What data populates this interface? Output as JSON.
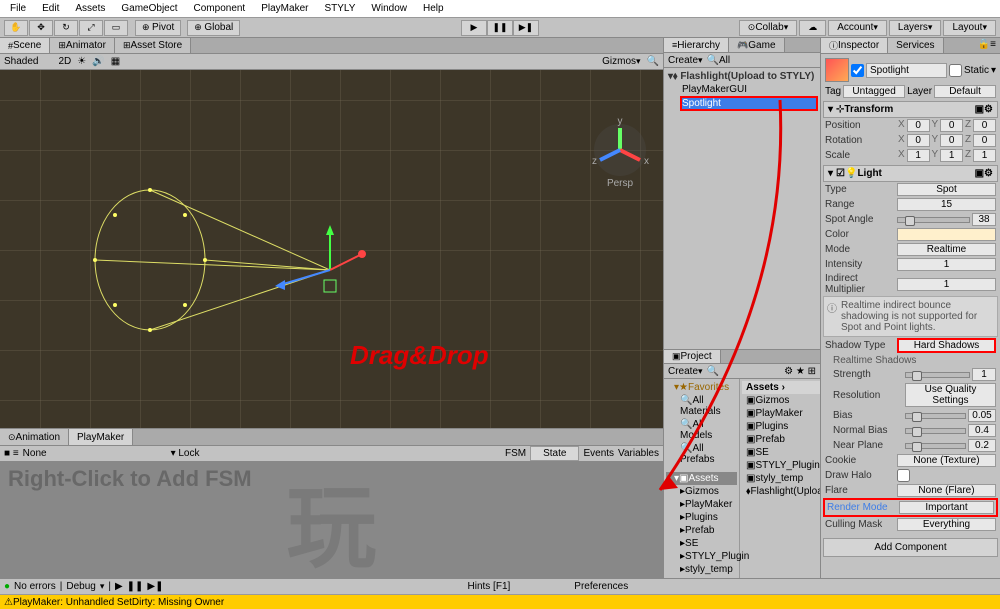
{
  "menu": [
    "File",
    "Edit",
    "Assets",
    "GameObject",
    "Component",
    "PlayMaker",
    "STYLY",
    "Window",
    "Help"
  ],
  "toolbar": {
    "pivot": "Pivot",
    "global": "Global",
    "collab": "Collab",
    "account": "Account",
    "layers": "Layers",
    "layout": "Layout"
  },
  "scene_tabs": {
    "scene": "Scene",
    "animator": "Animator",
    "asset_store": "Asset Store"
  },
  "scene_toolbar": {
    "shaded": "Shaded",
    "two_d": "2D",
    "gizmos": "Gizmos"
  },
  "anim_tabs": {
    "animation": "Animation",
    "playmaker": "PlayMaker"
  },
  "pm_toolbar": {
    "none": "None",
    "lock": "Lock",
    "fsm": "FSM",
    "state": "State",
    "events": "Events",
    "variables": "Variables"
  },
  "pm_hint": "Right-Click to Add FSM",
  "hier_tabs": {
    "hierarchy": "Hierarchy",
    "game": "Game"
  },
  "hier_toolbar": {
    "create": "Create"
  },
  "hierarchy": {
    "scene": "Flashlight(Upload to STYLY)",
    "items": [
      "PlayMakerGUI",
      "Spotlight"
    ]
  },
  "proj_tabs": {
    "project": "Project"
  },
  "proj_toolbar": {
    "create": "Create"
  },
  "project": {
    "favorites": "Favorites",
    "fav_items": [
      "All Materials",
      "All Models",
      "All Prefabs"
    ],
    "assets_root": "Assets",
    "tree": [
      "Gizmos",
      "PlayMaker",
      "Plugins",
      "Prefab",
      "SE",
      "STYLY_Plugin",
      "styly_temp"
    ],
    "breadcrumb": "Assets ›",
    "list": [
      "Gizmos",
      "PlayMaker",
      "Plugins",
      "Prefab",
      "SE",
      "STYLY_Plugin",
      "styly_temp",
      "Flashlight(Upload"
    ]
  },
  "insp_tabs": {
    "inspector": "Inspector",
    "services": "Services"
  },
  "inspector": {
    "name": "Spotlight",
    "static": "Static",
    "tag_label": "Tag",
    "tag": "Untagged",
    "layer_label": "Layer",
    "layer": "Default",
    "transform": "Transform",
    "position": "Position",
    "rotation": "Rotation",
    "scale": "Scale",
    "pos": {
      "x": "0",
      "y": "0",
      "z": "0"
    },
    "rot": {
      "x": "0",
      "y": "0",
      "z": "0"
    },
    "scl": {
      "x": "1",
      "y": "1",
      "z": "1"
    },
    "light": "Light",
    "type_label": "Type",
    "type": "Spot",
    "range_label": "Range",
    "range": "15",
    "spot_angle_label": "Spot Angle",
    "spot_angle": "38",
    "color_label": "Color",
    "mode_label": "Mode",
    "mode": "Realtime",
    "intensity_label": "Intensity",
    "intensity": "1",
    "indirect_label": "Indirect Multiplier",
    "indirect": "1",
    "warning": "Realtime indirect bounce shadowing is not supported for Spot and Point lights.",
    "shadow_type_label": "Shadow Type",
    "shadow_type": "Hard Shadows",
    "realtime_shadows": "Realtime Shadows",
    "strength_label": "Strength",
    "strength": "1",
    "resolution_label": "Resolution",
    "resolution": "Use Quality Settings",
    "bias_label": "Bias",
    "bias": "0.05",
    "normal_bias_label": "Normal Bias",
    "normal_bias": "0.4",
    "near_plane_label": "Near Plane",
    "near_plane": "0.2",
    "cookie_label": "Cookie",
    "cookie": "None (Texture)",
    "draw_halo_label": "Draw Halo",
    "flare_label": "Flare",
    "flare": "None (Flare)",
    "render_mode_label": "Render Mode",
    "render_mode": "Important",
    "culling_label": "Culling Mask",
    "culling": "Everything",
    "add_component": "Add Component"
  },
  "status": {
    "no_errors": "No errors",
    "debug": "Debug",
    "hints": "Hints [F1]",
    "prefs": "Preferences",
    "warning": "PlayMaker: Unhandled SetDirty: Missing Owner"
  },
  "annotation": "Drag&Drop",
  "watermark": "玩"
}
